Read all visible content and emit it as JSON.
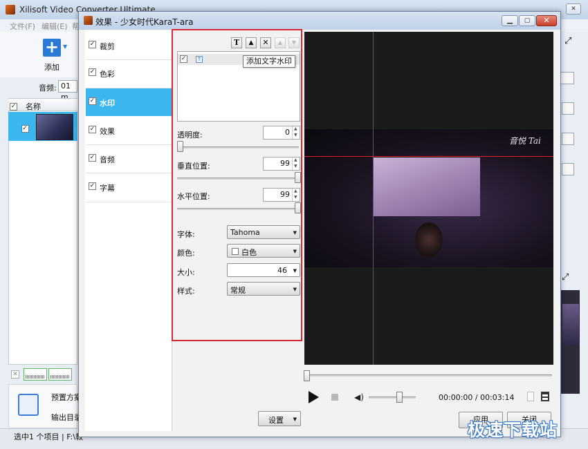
{
  "app": {
    "title": "Xilisoft Video Converter Ultimate",
    "menu": [
      "文件(F)",
      "编辑(E)",
      "帮"
    ],
    "add_label": "添加",
    "audio_label": "音频:",
    "audio_value": "01 m",
    "list_header": "名称",
    "preset_label": "预置方案",
    "output_label": "输出目录",
    "status": "选中1 个项目 | F:\\教"
  },
  "dialog": {
    "title": "效果 - 少女时代KaraT-ara",
    "nav": [
      {
        "label": "裁剪",
        "checked": true
      },
      {
        "label": "色彩",
        "checked": true
      },
      {
        "label": "水印",
        "checked": true,
        "selected": true
      },
      {
        "label": "效果",
        "checked": true
      },
      {
        "label": "音频",
        "checked": true
      },
      {
        "label": "字幕",
        "checked": true
      }
    ],
    "watermark": {
      "tooltip": "添加文字水印",
      "opacity_label": "透明度:",
      "opacity_value": "0",
      "vertical_label": "垂直位置:",
      "vertical_value": "99",
      "horizontal_label": "水平位置:",
      "horizontal_value": "99",
      "font_label": "字体:",
      "font_value": "Tahoma",
      "color_label": "颜色:",
      "color_value": "白色",
      "size_label": "大小:",
      "size_value": "46",
      "style_label": "样式:",
      "style_value": "常规",
      "preview_text": "音悦 Tai"
    },
    "settings_label": "设置",
    "player": {
      "time": "00:00:00 / 00:03:14"
    },
    "apply_label": "应用",
    "close_label": "关闭"
  },
  "site_watermark": "极速下载站",
  "colors": {
    "selection": "#3cb6ee",
    "highlight_box": "#d8282f",
    "guide_line": "#e02020"
  }
}
